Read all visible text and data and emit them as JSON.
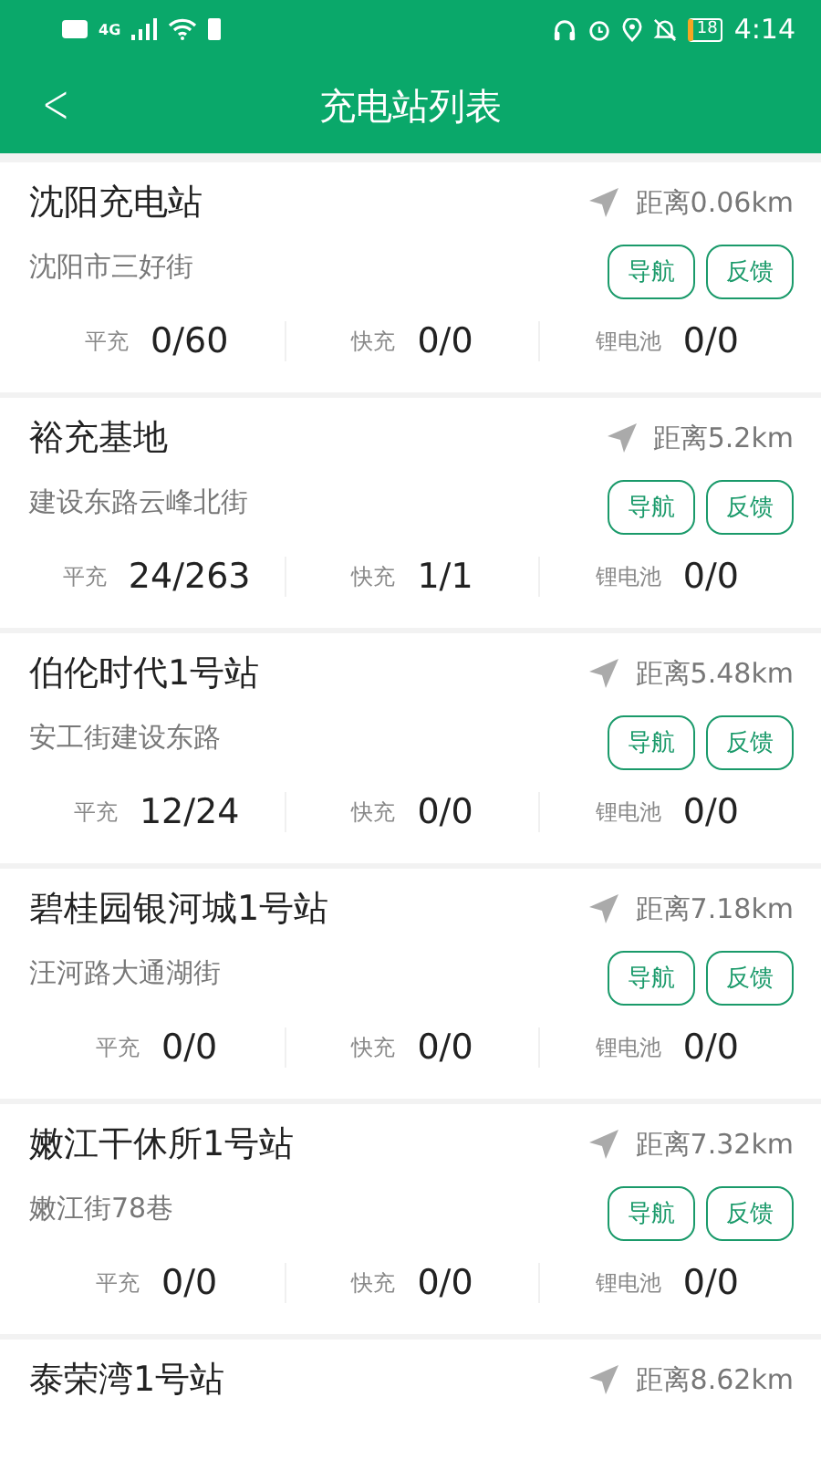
{
  "status_bar": {
    "time": "4:14",
    "battery": "18",
    "network": "4G"
  },
  "header": {
    "back": "<",
    "title": "充电站列表"
  },
  "stations": [
    {
      "name": "沈阳充电站",
      "distance": "距离0.06km",
      "address": "沈阳市三好街",
      "buttons": [
        "导航",
        "反馈"
      ],
      "stats": [
        {
          "label": "平充",
          "value": "0/60"
        },
        {
          "label": "快充",
          "value": "0/0"
        },
        {
          "label": "锂电池",
          "value": "0/0"
        }
      ]
    },
    {
      "name": "裕充基地",
      "distance": "距离5.2km",
      "address": "建设东路云峰北街",
      "buttons": [
        "导航",
        "反馈"
      ],
      "stats": [
        {
          "label": "平充",
          "value": "24/263"
        },
        {
          "label": "快充",
          "value": "1/1"
        },
        {
          "label": "锂电池",
          "value": "0/0"
        }
      ]
    },
    {
      "name": "伯伦时代1号站",
      "distance": "距离5.48km",
      "address": "安工街建设东路",
      "buttons": [
        "导航",
        "反馈"
      ],
      "stats": [
        {
          "label": "平充",
          "value": "12/24"
        },
        {
          "label": "快充",
          "value": "0/0"
        },
        {
          "label": "锂电池",
          "value": "0/0"
        }
      ]
    },
    {
      "name": "碧桂园银河城1号站",
      "distance": "距离7.18km",
      "address": "汪河路大通湖街",
      "buttons": [
        "导航",
        "反馈"
      ],
      "stats": [
        {
          "label": "平充",
          "value": "0/0"
        },
        {
          "label": "快充",
          "value": "0/0"
        },
        {
          "label": "锂电池",
          "value": "0/0"
        }
      ]
    },
    {
      "name": "嫩江干休所1号站",
      "distance": "距离7.32km",
      "address": "嫩江街78巷",
      "buttons": [
        "导航",
        "反馈"
      ],
      "stats": [
        {
          "label": "平充",
          "value": "0/0"
        },
        {
          "label": "快充",
          "value": "0/0"
        },
        {
          "label": "锂电池",
          "value": "0/0"
        }
      ]
    },
    {
      "name": "泰荣湾1号站",
      "distance": "距离8.62km"
    }
  ]
}
